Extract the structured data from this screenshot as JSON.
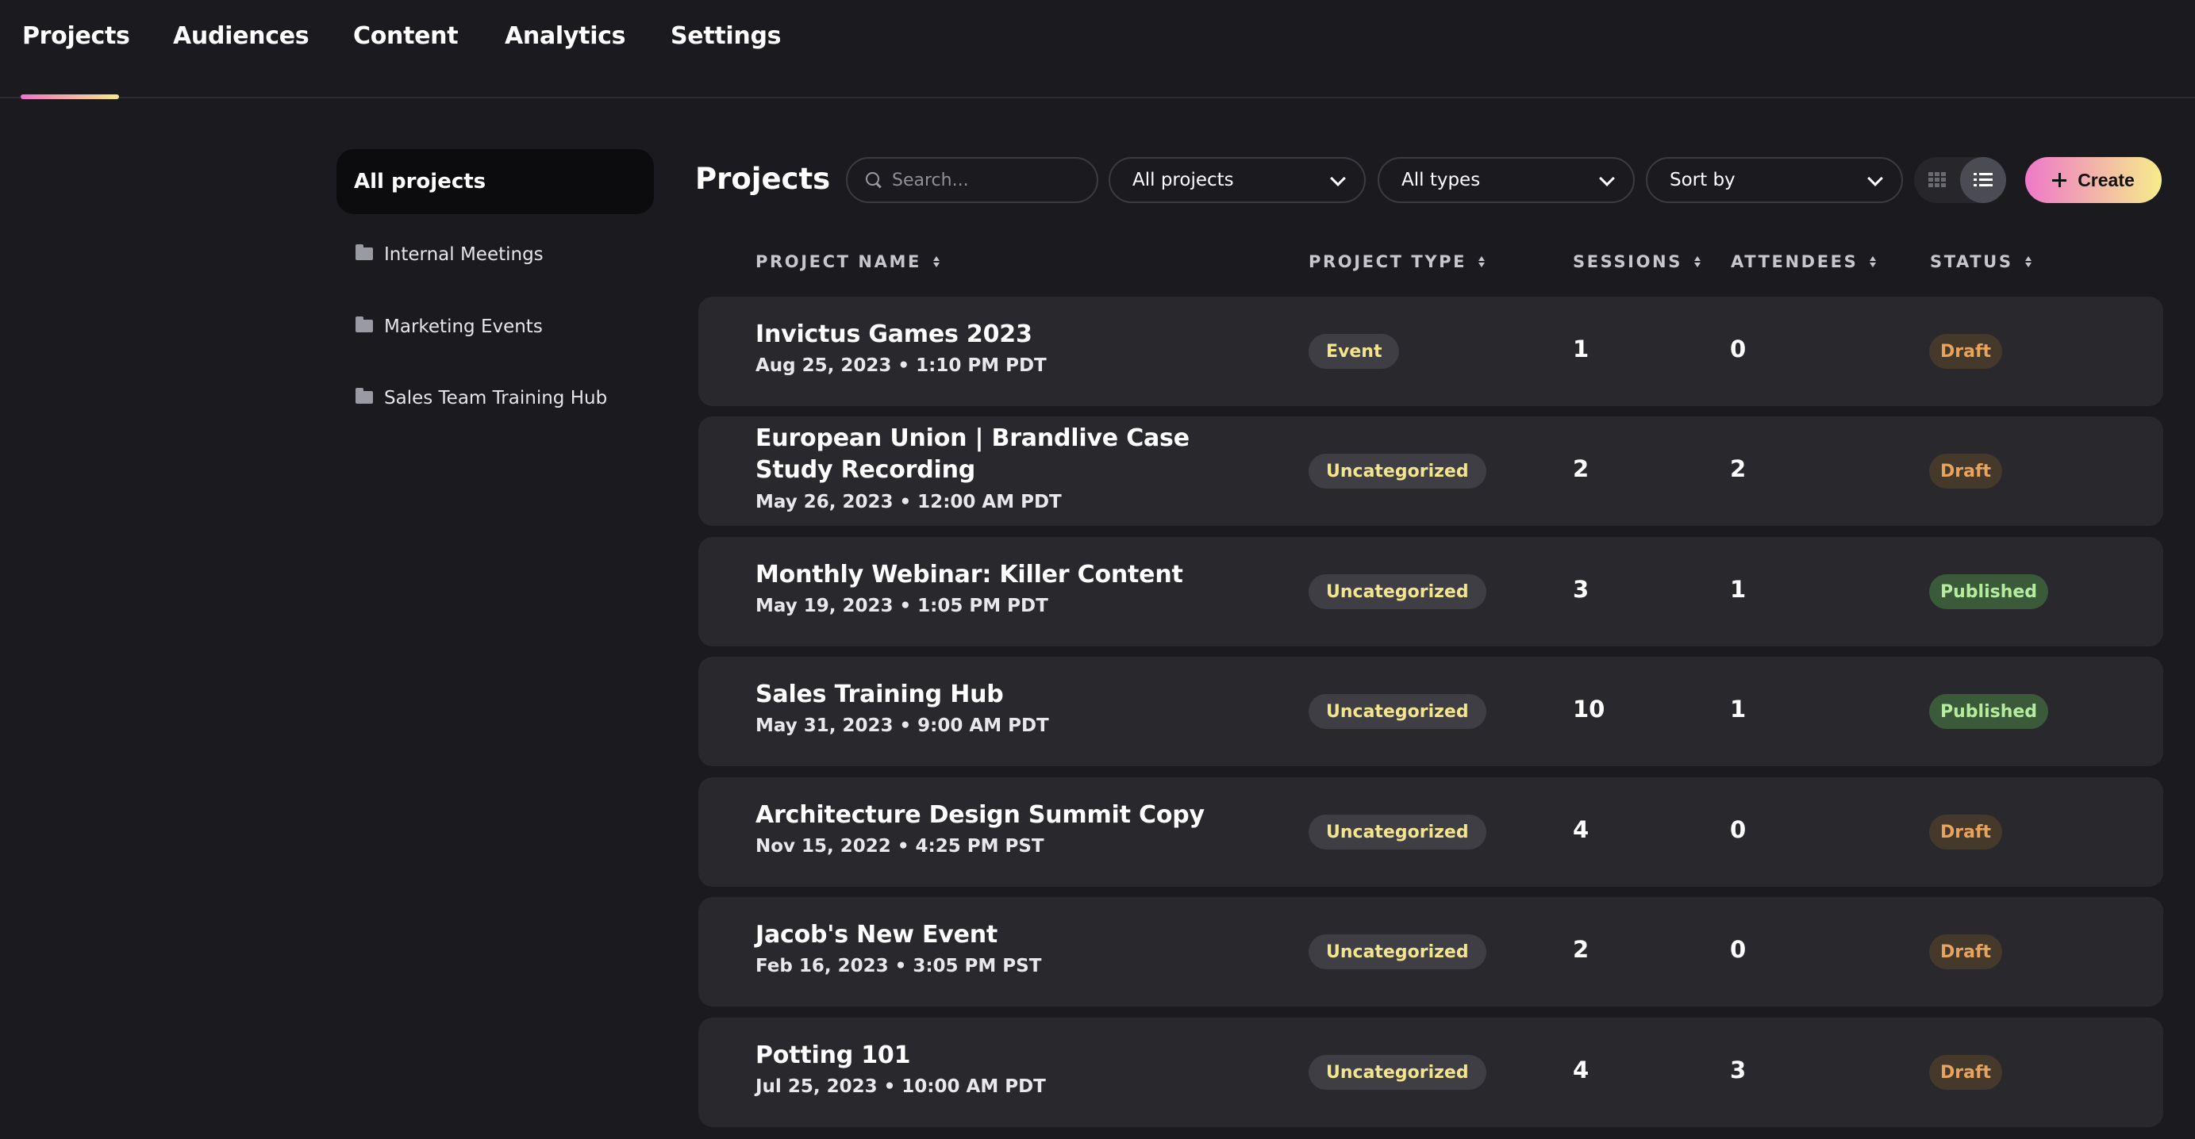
{
  "nav": {
    "tabs": [
      {
        "label": "Projects",
        "active": true
      },
      {
        "label": "Audiences"
      },
      {
        "label": "Content"
      },
      {
        "label": "Analytics"
      },
      {
        "label": "Settings"
      }
    ],
    "accent_gradient": [
      "#ee74c8",
      "#f5e98a"
    ]
  },
  "sidebar": {
    "all_label": "All projects",
    "folders": [
      {
        "label": "Internal Meetings",
        "icon": "folder-icon"
      },
      {
        "label": "Marketing Events",
        "icon": "folder-icon"
      },
      {
        "label": "Sales Team Training Hub",
        "icon": "folder-icon"
      }
    ]
  },
  "toolbar": {
    "title": "Projects",
    "search_placeholder": "Search...",
    "filter_projects": "All projects",
    "filter_types": "All types",
    "sort_label": "Sort by",
    "create_label": "Create",
    "view_mode": "list"
  },
  "table": {
    "columns": {
      "name": "PROJECT NAME",
      "type": "PROJECT TYPE",
      "sessions": "SESSIONS",
      "attendees": "ATTENDEES",
      "status": "STATUS"
    },
    "rows": [
      {
        "name": "Invictus Games 2023",
        "date": "Aug 25, 2023 • 1:10 PM PDT",
        "type": "Event",
        "sessions": "1",
        "attendees": "0",
        "status": "Draft"
      },
      {
        "name": "European Union | Brandlive Case Study Recording",
        "date": "May 26, 2023 • 12:00 AM PDT",
        "type": "Uncategorized",
        "sessions": "2",
        "attendees": "2",
        "status": "Draft"
      },
      {
        "name": "Monthly Webinar: Killer Content",
        "date": "May 19, 2023 • 1:05 PM PDT",
        "type": "Uncategorized",
        "sessions": "3",
        "attendees": "1",
        "status": "Published"
      },
      {
        "name": "Sales Training Hub",
        "date": "May 31, 2023 • 9:00 AM PDT",
        "type": "Uncategorized",
        "sessions": "10",
        "attendees": "1",
        "status": "Published"
      },
      {
        "name": "Architecture Design Summit Copy",
        "date": "Nov 15, 2022 • 4:25 PM PST",
        "type": "Uncategorized",
        "sessions": "4",
        "attendees": "0",
        "status": "Draft"
      },
      {
        "name": "Jacob's New Event",
        "date": "Feb 16, 2023 • 3:05 PM PST",
        "type": "Uncategorized",
        "sessions": "2",
        "attendees": "0",
        "status": "Draft"
      },
      {
        "name": "Potting 101",
        "date": "Jul 25, 2023 • 10:00 AM PDT",
        "type": "Uncategorized",
        "sessions": "4",
        "attendees": "3",
        "status": "Draft"
      }
    ]
  },
  "colors": {
    "background": "#1b1b1f",
    "row": "#28282d",
    "draft": "#e8a35c",
    "published": "#b6ec9e",
    "type_badge_text": "#f3e58f"
  }
}
